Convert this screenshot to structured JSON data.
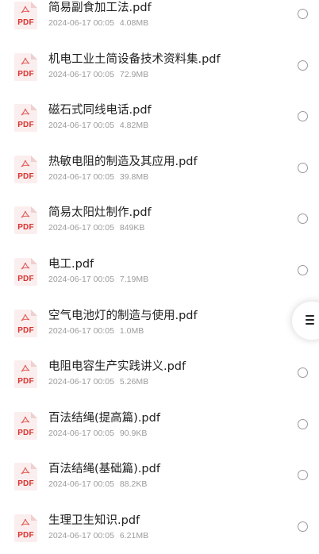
{
  "files": [
    {
      "name": "简易副食加工法.pdf",
      "date": "2024-06-17 00:05",
      "size": "4.08MB",
      "icon": "pdf-file-icon",
      "type_label": "PDF"
    },
    {
      "name": "机电工业土简设备技术资料集.pdf",
      "date": "2024-06-17 00:05",
      "size": "72.9MB",
      "icon": "pdf-file-icon",
      "type_label": "PDF"
    },
    {
      "name": "磁石式同线电话.pdf",
      "date": "2024-06-17 00:05",
      "size": "4.82MB",
      "icon": "pdf-file-icon",
      "type_label": "PDF"
    },
    {
      "name": "热敏电阻的制造及其应用.pdf",
      "date": "2024-06-17 00:05",
      "size": "39.8MB",
      "icon": "pdf-file-icon",
      "type_label": "PDF"
    },
    {
      "name": "简易太阳灶制作.pdf",
      "date": "2024-06-17 00:05",
      "size": "849KB",
      "icon": "pdf-file-icon",
      "type_label": "PDF"
    },
    {
      "name": "电工.pdf",
      "date": "2024-06-17 00:05",
      "size": "7.19MB",
      "icon": "pdf-file-icon",
      "type_label": "PDF"
    },
    {
      "name": "空气电池灯的制造与使用.pdf",
      "date": "2024-06-17 00:05",
      "size": "1.0MB",
      "icon": "pdf-file-icon",
      "type_label": "PDF"
    },
    {
      "name": "电阻电容生产实践讲义.pdf",
      "date": "2024-06-17 00:05",
      "size": "5.26MB",
      "icon": "pdf-file-icon",
      "type_label": "PDF"
    },
    {
      "name": "百法结绳(提高篇).pdf",
      "date": "2024-06-17 00:05",
      "size": "90.9KB",
      "icon": "pdf-file-icon",
      "type_label": "PDF"
    },
    {
      "name": "百法结绳(基础篇).pdf",
      "date": "2024-06-17 00:05",
      "size": "88.2KB",
      "icon": "pdf-file-icon",
      "type_label": "PDF"
    },
    {
      "name": "生理卫生知识.pdf",
      "date": "2024-06-17 00:05",
      "size": "6.21MB",
      "icon": "pdf-file-icon",
      "type_label": "PDF"
    }
  ],
  "floating_menu": {
    "icon": "menu-icon"
  },
  "colors": {
    "pdf_red": "#d9322e",
    "pdf_bg": "#fbeeee",
    "name_text": "#1f1f1f",
    "meta_text": "#9b9b9b",
    "radio_border": "#9a9a9a"
  }
}
